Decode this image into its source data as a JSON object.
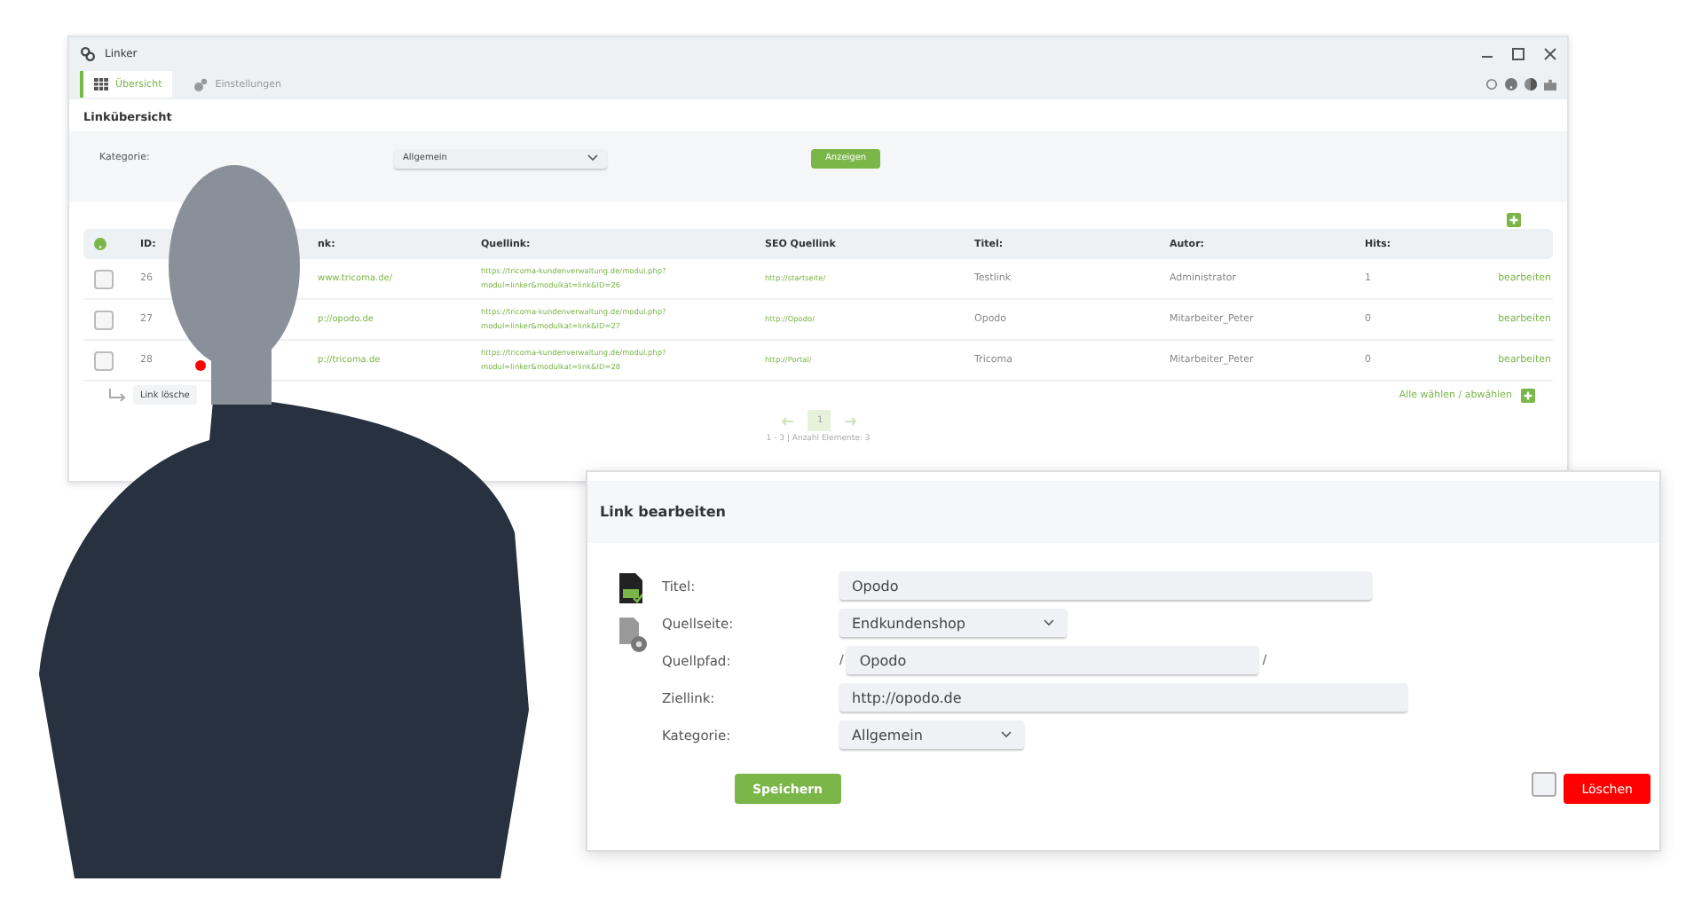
{
  "window": {
    "title": "Linker"
  },
  "tabs": [
    {
      "label": "Übersicht",
      "selected": true
    },
    {
      "label": "Einstellungen",
      "selected": false
    }
  ],
  "section_title": "Linkübersicht",
  "filter": {
    "label": "Kategorie:",
    "value": "Allgemein",
    "button": "Anzeigen"
  },
  "table": {
    "columns": [
      "ID:",
      "nk:",
      "Quellink:",
      "SEO Quellink",
      "Titel:",
      "Autor:",
      "Hits:"
    ],
    "rows": [
      {
        "checked": false,
        "marked": false,
        "id": "26",
        "target": "www.tricoma.de/",
        "source": [
          "https://tricoma-kundenverwaltung.de/modul.php?",
          "modul=linker&modulkat=link&ID=26"
        ],
        "seo": "http://startseite/",
        "title": "Testlink",
        "author": "Administrator",
        "hits": "1",
        "action": "bearbeiten"
      },
      {
        "checked": false,
        "marked": false,
        "id": "27",
        "target": "p://opodo.de",
        "source": [
          "https://tricoma-kundenverwaltung.de/modul.php?",
          "modul=linker&modulkat=link&ID=27"
        ],
        "seo": "http://Opodo/",
        "title": "Opodo",
        "author": "Mitarbeiter_Peter",
        "hits": "0",
        "action": "bearbeiten"
      },
      {
        "checked": false,
        "marked": true,
        "id": "28",
        "target": "p://tricoma.de",
        "source": [
          "https://tricoma-kundenverwaltung.de/modul.php?",
          "modul=linker&modulkat=link&ID=28"
        ],
        "seo": "http://Portal/",
        "title": "Tricoma",
        "author": "Mitarbeiter_Peter",
        "hits": "0",
        "action": "bearbeiten"
      }
    ]
  },
  "delete_button": "Link lösche",
  "select_all": "Alle wählen / abwählen",
  "pagination": {
    "pages": [
      {
        "label": "1",
        "selected": true
      }
    ]
  },
  "footer": "1 - 3 | Anzahl Elemente: 3",
  "dialog": {
    "title": "Link bearbeiten",
    "fields": [
      {
        "kind": "text",
        "label": "Titel:",
        "value": "Opodo"
      },
      {
        "kind": "select",
        "label": "Quellseite:",
        "value": "Endkundenshop"
      },
      {
        "kind": "path",
        "label": "Quellpfad:",
        "prefix": "/",
        "value": "Opodo",
        "suffix": "/"
      },
      {
        "kind": "text",
        "label": "Ziellink:",
        "value": "http://opodo.de"
      },
      {
        "kind": "select",
        "label": "Kategorie:",
        "value": "Allgemein"
      }
    ],
    "save": "Speichern",
    "confirm_checked": false,
    "delete": "Löschen"
  }
}
